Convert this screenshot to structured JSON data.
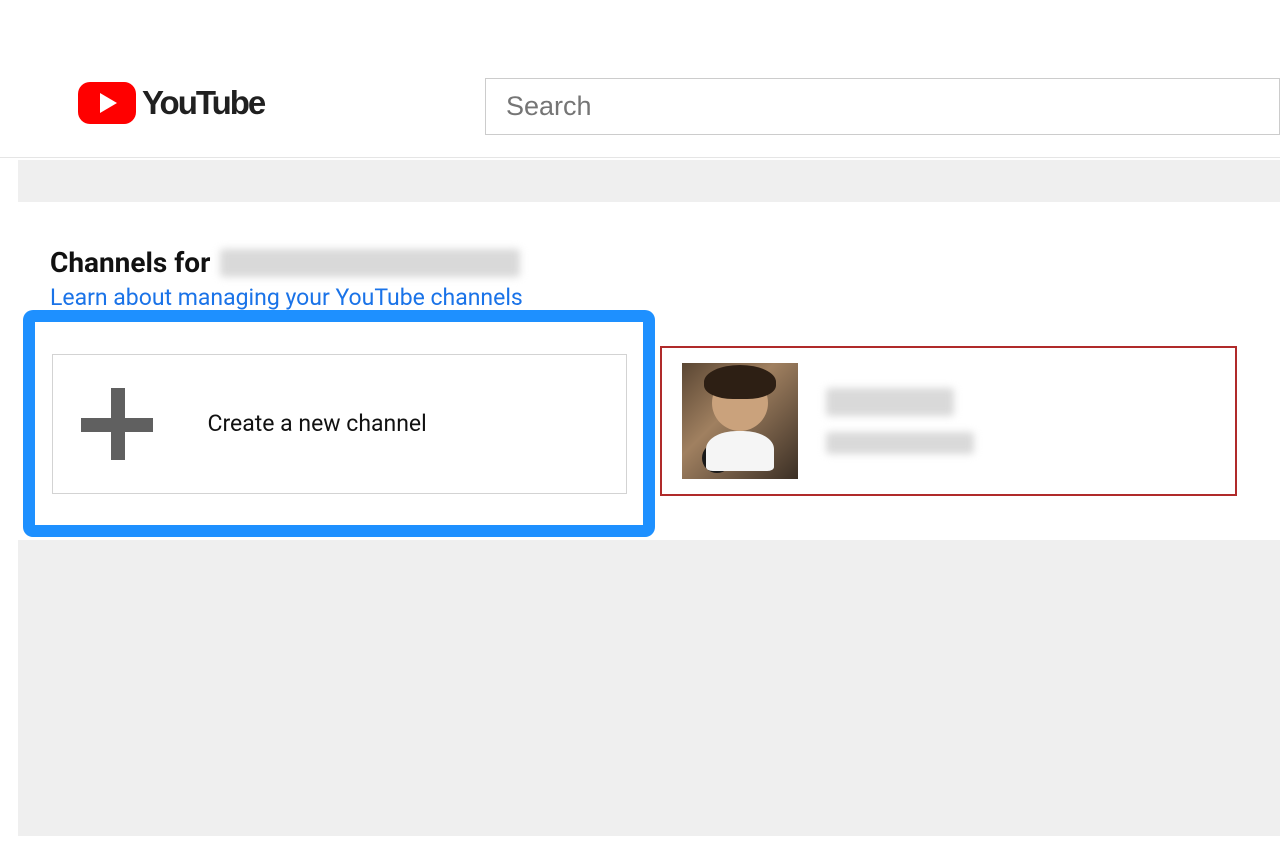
{
  "brand": "YouTube",
  "search": {
    "placeholder": "Search"
  },
  "heading": {
    "prefix": "Channels for"
  },
  "learn_link": "Learn about managing your YouTube channels",
  "create_card": {
    "label": "Create a new channel"
  },
  "colors": {
    "highlight_blue": "#1e90ff",
    "highlight_red": "#b02a2a",
    "link": "#1a73e8",
    "brand_red": "#ff0000"
  }
}
